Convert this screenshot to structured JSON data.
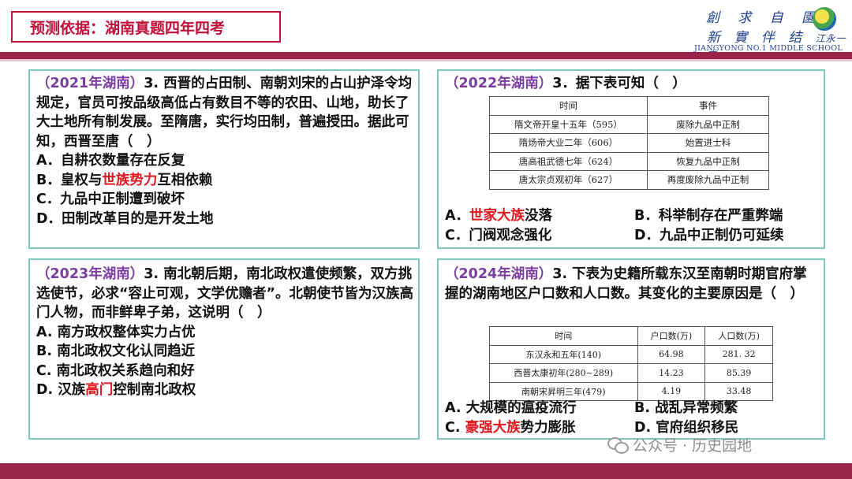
{
  "header": {
    "title": "预测依据：湖南真题四年四考",
    "logo_line1": "創 求 自 園",
    "logo_line2a": "新 實 伴 结",
    "logo_line2b": "江永一中",
    "logo_school": "JIANGYONG NO.1 MIDDLE SCHOOL"
  },
  "q2021": {
    "source": "（2021年湖南）",
    "stem": "3. 西晋的占田制、南朝刘宋的占山护泽令均规定，官员可按品级高低占有数目不等的农田、山地，助长了大土地所有制发展。至隋唐，实行均田制，普遍授田。据此可知，西晋至唐（　）",
    "opt_a": "A．自耕农数量存在反复",
    "opt_b_pre": "B．皇权与",
    "opt_b_red": "世族势力",
    "opt_b_post": "互相依赖",
    "opt_c": "C．九品中正制遭到破坏",
    "opt_d": "D．田制改革目的是开发土地"
  },
  "q2022": {
    "source": "（2022年湖南）",
    "stem": "3．据下表可知（　）",
    "table_headers": [
      "时间",
      "事件"
    ],
    "table_rows": [
      [
        "隋文帝开皇十五年（595）",
        "废除九品中正制"
      ],
      [
        "隋炀帝大业二年（606）",
        "始置进士科"
      ],
      [
        "唐高祖武德七年（624）",
        "恢复九品中正制"
      ],
      [
        "唐太宗贞观初年（627）",
        "再度废除九品中正制"
      ]
    ],
    "opt_a_pre": "A．",
    "opt_a_red": "世家大族",
    "opt_a_post": "没落",
    "opt_b": "B．科举制存在严重弊端",
    "opt_c": "C．门阀观念强化",
    "opt_d": "D．九品中正制仍可延续"
  },
  "q2023": {
    "source": "（2023年湖南）",
    "stem": "3. 南北朝后期，南北政权遣使频繁，双方挑选使节，必求“容止可观，文学优赡者”。北朝使节皆为汉族高门人物，而非鲜卑子弟，这说明（　）",
    "opt_a": "A. 南方政权整体实力占优",
    "opt_b": "B. 南北政权文化认同趋近",
    "opt_c": "C. 南北政权关系趋向和好",
    "opt_d_pre": "D. 汉族",
    "opt_d_red": "高门",
    "opt_d_post": "控制南北政权"
  },
  "q2024": {
    "source": "（2024年湖南）",
    "stem": "3.  下表为史籍所载东汉至南朝时期官府掌握的湖南地区户口数和人口数。其变化的主要原因是（　）",
    "table_headers": [
      "时间",
      "户口数(万)",
      "人口数(万)"
    ],
    "table_rows": [
      [
        "东汉永和五年(140)",
        "64.98",
        "281. 32"
      ],
      [
        "西晋太康初年(280~289)",
        "14.23",
        "85.39"
      ],
      [
        "南朝宋昇明三年(479)",
        "4.19",
        "33.48"
      ]
    ],
    "opt_a": "A. 大规模的瘟疫流行",
    "opt_b": "B. 战乱异常频繁",
    "opt_c_pre": "C. ",
    "opt_c_red": "豪强大族",
    "opt_c_post": "势力膨胀",
    "opt_d": "D. 官府组织移民"
  },
  "watermark": "公众号 · 历史园地",
  "colors": {
    "accent": "#c0103a",
    "band": "#9a2448",
    "panel_border": "#7ec7bd",
    "source": "#7b3ea0",
    "highlight": "#e0171f"
  }
}
